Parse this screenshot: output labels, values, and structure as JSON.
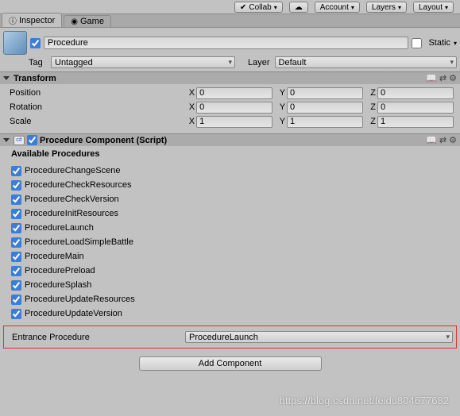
{
  "toolbar": {
    "collab": "Collab",
    "account": "Account",
    "layers": "Layers",
    "layout": "Layout"
  },
  "tabs": {
    "inspector": "Inspector",
    "game": "Game"
  },
  "header": {
    "name": "Procedure",
    "static_label": "Static",
    "tag_label": "Tag",
    "tag_value": "Untagged",
    "layer_label": "Layer",
    "layer_value": "Default"
  },
  "transform": {
    "title": "Transform",
    "rows": [
      {
        "label": "Position",
        "x": "0",
        "y": "0",
        "z": "0"
      },
      {
        "label": "Rotation",
        "x": "0",
        "y": "0",
        "z": "0"
      },
      {
        "label": "Scale",
        "x": "1",
        "y": "1",
        "z": "1"
      }
    ],
    "axis": {
      "x": "X",
      "y": "Y",
      "z": "Z"
    }
  },
  "component": {
    "title": "Procedure Component (Script)",
    "available_title": "Available Procedures",
    "procedures": [
      "ProcedureChangeScene",
      "ProcedureCheckResources",
      "ProcedureCheckVersion",
      "ProcedureInitResources",
      "ProcedureLaunch",
      "ProcedureLoadSimpleBattle",
      "ProcedureMain",
      "ProcedurePreload",
      "ProcedureSplash",
      "ProcedureUpdateResources",
      "ProcedureUpdateVersion"
    ],
    "entrance_label": "Entrance Procedure",
    "entrance_value": "ProcedureLaunch"
  },
  "add_component": "Add Component",
  "watermark": "https://blog.csdn.net/feidu804677682"
}
